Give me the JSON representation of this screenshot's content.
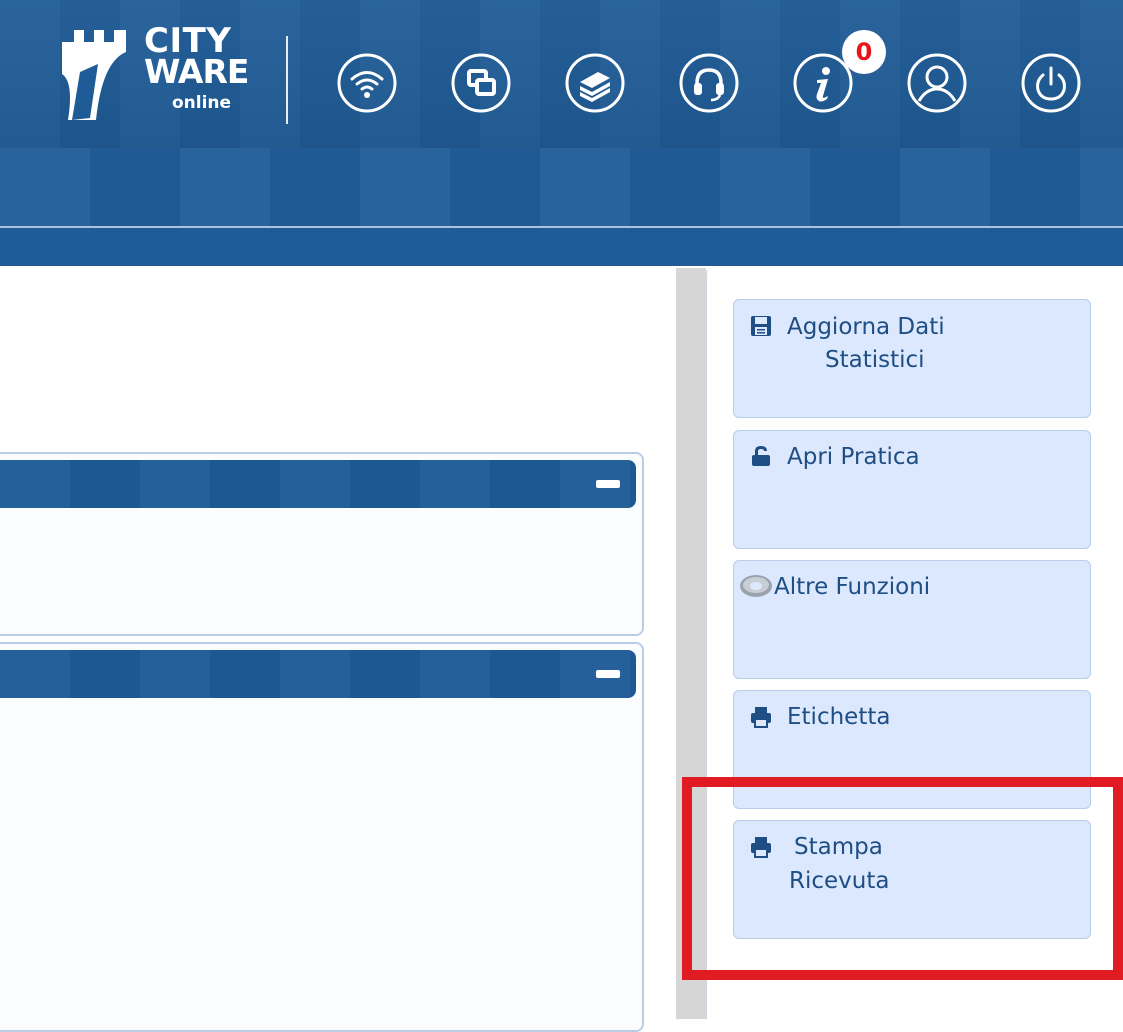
{
  "header": {
    "logo": {
      "line1": "CITY",
      "line2": "WARE",
      "line3": "online"
    },
    "icons": [
      {
        "name": "wifi-icon"
      },
      {
        "name": "windows-icon"
      },
      {
        "name": "books-icon"
      },
      {
        "name": "headset-icon"
      },
      {
        "name": "info-icon"
      },
      {
        "name": "user-icon"
      },
      {
        "name": "power-icon"
      }
    ],
    "notification_count": "0"
  },
  "sidebar": {
    "buttons": [
      {
        "label_line1": "Aggiorna Dati",
        "label_line2": "Statistici",
        "icon": "save-icon"
      },
      {
        "label_line1": "Apri Pratica",
        "label_line2": "",
        "icon": "unlock-icon"
      },
      {
        "label_line1": "Altre Funzioni",
        "label_line2": "",
        "icon": "gear-icon"
      },
      {
        "label_line1": "Etichetta",
        "label_line2": "",
        "icon": "print-icon"
      },
      {
        "label_line1": "Stampa",
        "label_line2": "Ricevuta",
        "icon": "print-icon"
      }
    ]
  },
  "colors": {
    "header_blue": "#1f5b97",
    "button_bg": "#dbe8fd",
    "button_text": "#1f4e84",
    "highlight": "#e01b22"
  }
}
